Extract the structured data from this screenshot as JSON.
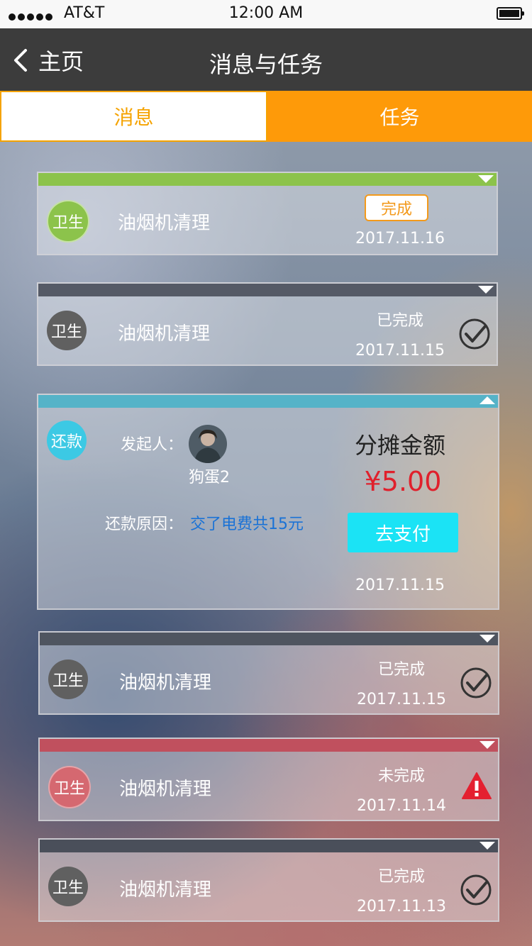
{
  "status_bar": {
    "carrier": "AT&T",
    "time": "12:00 AM"
  },
  "nav": {
    "back_label": "主页",
    "title": "消息与任务"
  },
  "tabs": [
    {
      "label": "消息"
    },
    {
      "label": "任务"
    }
  ],
  "cards": [
    {
      "badge": "卫生",
      "title": "油烟机清理",
      "action_label": "完成",
      "date": "2017.11.16",
      "bar_color": "#8cc34b",
      "badge_color": "#8cc34b"
    },
    {
      "badge": "卫生",
      "title": "油烟机清理",
      "state": "已完成",
      "date": "2017.11.15",
      "bar_color": "#555a66",
      "badge_color": "#606060",
      "icon": "check-circle-icon"
    },
    {
      "badge": "还款",
      "initiator_label": "发起人：",
      "initiator_name": "狗蛋2",
      "reason_label": "还款原因：",
      "reason_value": "交了电费共15元",
      "amount_title": "分摊金额",
      "amount": "¥5.00",
      "pay_label": "去支付",
      "date": "2017.11.15",
      "bar_color": "#55b3c8",
      "badge_color": "#3cc9e4"
    },
    {
      "badge": "卫生",
      "title": "油烟机清理",
      "state": "已完成",
      "date": "2017.11.15",
      "bar_color": "#4f5560",
      "badge_color": "#606060",
      "icon": "check-circle-icon"
    },
    {
      "badge": "卫生",
      "title": "油烟机清理",
      "state": "未完成",
      "date": "2017.11.14",
      "bar_color": "#c0505e",
      "badge_color": "#d56870",
      "icon": "warning-icon"
    },
    {
      "badge": "卫生",
      "title": "油烟机清理",
      "state": "已完成",
      "date": "2017.11.13",
      "bar_color": "#4a4f5a",
      "badge_color": "#606060",
      "icon": "check-circle-icon"
    }
  ]
}
